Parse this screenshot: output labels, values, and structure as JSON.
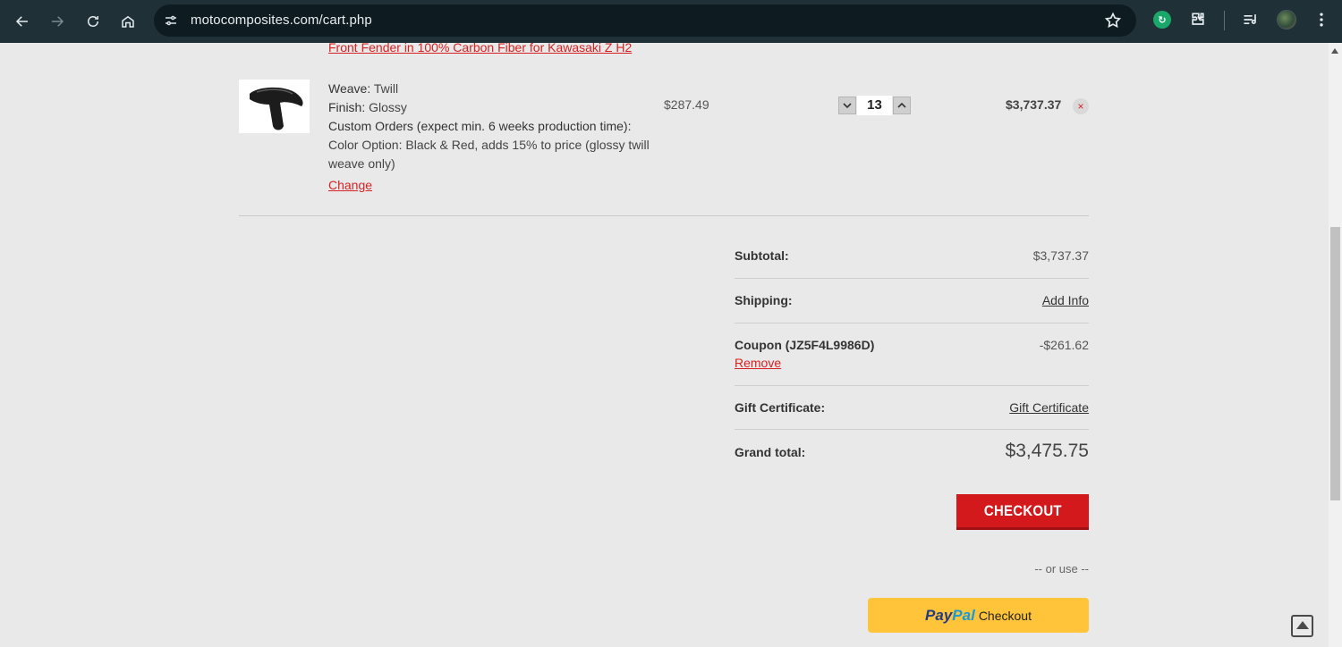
{
  "browser": {
    "url": "motocomposites.com/cart.php",
    "icons": [
      "back-icon",
      "forward-icon",
      "reload-icon",
      "home-icon",
      "site-info-icon",
      "star-icon",
      "extension-icon",
      "puzzle-icon",
      "media-icon",
      "profile-avatar",
      "more-icon"
    ],
    "extension_badge": "↻"
  },
  "cart_item": {
    "title": "Front Fender in 100% Carbon Fiber for Kawasaki Z H2",
    "options": [
      {
        "label": "Weave:",
        "value": "Twill"
      },
      {
        "label": "Finish:",
        "value": "Glossy"
      },
      {
        "label": "Custom Orders (expect min. 6 weeks production time):",
        "value": ""
      },
      {
        "label": "",
        "value": "Color Option: Black & Red, adds 15% to price (glossy twill weave only)"
      }
    ],
    "change_label": "Change",
    "unit_price": "$287.49",
    "quantity": "13",
    "line_total": "$3,737.37",
    "remove_symbol": "×"
  },
  "totals": {
    "subtotal_label": "Subtotal:",
    "subtotal_value": "$3,737.37",
    "shipping_label": "Shipping:",
    "shipping_link": "Add Info",
    "coupon_label": "Coupon (JZ5F4L9986D)",
    "coupon_value": "-$261.62",
    "coupon_remove": "Remove",
    "gift_label": "Gift Certificate:",
    "gift_link": "Gift Certificate",
    "grand_label": "Grand total:",
    "grand_value": "$3,475.75"
  },
  "checkout": {
    "button_label": "CHECKOUT",
    "or_use": "-- or use --",
    "paypal_brand_1": "Pay",
    "paypal_brand_2": "Pal",
    "paypal_label": "Checkout"
  },
  "colors": {
    "accent_red": "#d4191c",
    "link_red": "#d62222",
    "paypal_yellow": "#ffc439",
    "chrome_bg": "#1f3036",
    "page_bg": "#e9e9e9"
  }
}
